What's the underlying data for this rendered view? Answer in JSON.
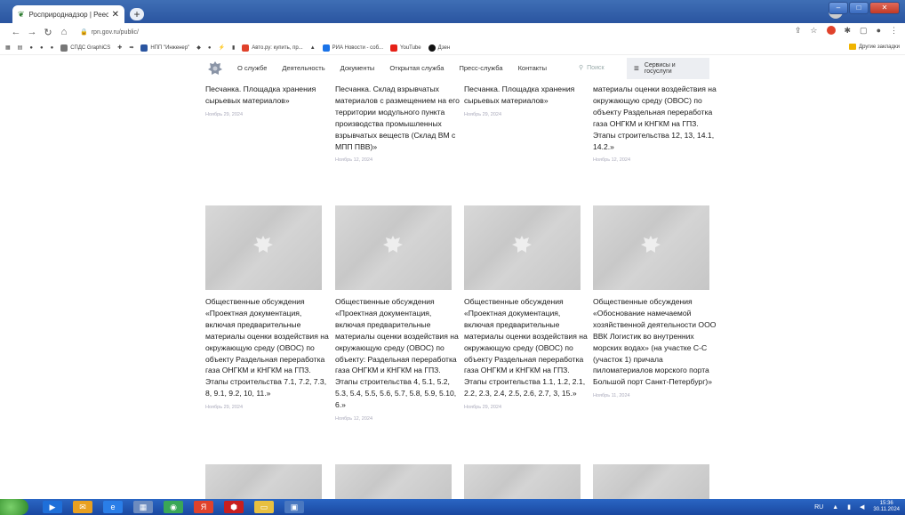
{
  "browser": {
    "tab_title": "Росприроднадзор | Реестр мате",
    "tab_close": "✕",
    "new_tab": "+",
    "url": "rpn.gov.ru/public/",
    "nav_back": "←",
    "nav_forward": "→",
    "nav_reload": "↻",
    "nav_home": "⌂",
    "bookmarks": [
      {
        "label": "СПДС GraphiCS",
        "color": "#777"
      },
      {
        "label": "НПП \"Инженер\"",
        "color": "#2a55a0"
      },
      {
        "label": "Авто.ру: купить, пр...",
        "color": "#e0422b"
      },
      {
        "label": "РИА Новости - соб...",
        "color": "#1a73e8"
      },
      {
        "label": "YouTube",
        "color": "#e62117"
      },
      {
        "label": "Дзен",
        "color": "#111"
      }
    ],
    "other_bookmarks": "Другие закладки"
  },
  "site": {
    "menu": [
      "О службе",
      "Деятельность",
      "Документы",
      "Открытая служба",
      "Пресс-служба",
      "Контакты"
    ],
    "search_placeholder": "Поиск",
    "services_line1": "Сервисы и",
    "services_line2": "госуслуги"
  },
  "top_cards": [
    {
      "title": "Песчанка. Площадка хранения сырьевых материалов»",
      "date": "Ноябрь 29, 2024"
    },
    {
      "title": "Песчанка. Склад взрывчатых материалов с размещением на его территории модульного пункта производства промышленных взрывчатых веществ (Склад ВМ с МПП ПВВ)»",
      "date": "Ноябрь 12, 2024"
    },
    {
      "title": "Песчанка. Площадка хранения сырьевых материалов»",
      "date": "Ноябрь 29, 2024"
    },
    {
      "title": "материалы оценки воздействия на окружающую среду (ОВОС) по объекту Раздельная переработка газа ОНГКМ и КНГКМ на ГПЗ. Этапы строительства 12, 13, 14.1, 14.2.»",
      "date": "Ноябрь 12, 2024"
    }
  ],
  "cards": [
    {
      "title": "Общественные обсуждения «Проектная документация, включая предварительные материалы оценки воздействия на окружающую среду (ОВОС) по объекту Раздельная переработка газа ОНГКМ и КНГКМ на ГПЗ. Этапы строительства 7.1, 7.2, 7.3, 8, 9.1, 9.2, 10, 11.»",
      "date": "Ноябрь 29, 2024"
    },
    {
      "title": "Общественные обсуждения «Проектная документация, включая предварительные материалы оценки воздействия на окружающую среду (ОВОС) по объекту: Раздельная переработка газа ОНГКМ и КНГКМ на ГПЗ. Этапы строительства 4, 5.1, 5.2, 5.3, 5.4, 5.5, 5.6, 5.7, 5.8, 5.9, 5.10, 6.»",
      "date": "Ноябрь 12, 2024"
    },
    {
      "title": "Общественные обсуждения «Проектная документация, включая предварительные материалы оценки воздействия на окружающую среду (ОВОС) по объекту Раздельная переработка газа ОНГКМ и КНГКМ на ГПЗ. Этапы строительства 1.1, 1.2, 2.1, 2.2, 2.3, 2.4, 2.5, 2.6, 2.7, 3, 15.»",
      "date": "Ноябрь 29, 2024"
    },
    {
      "title": "Общественные обсуждения «Обоснование намечаемой хозяйственной деятельности ООО ВВК Логистик во внутренних морских водах» (на участке С-С (участок 1) причала пиломатериалов морского порта Большой порт Санкт-Петербург)»",
      "date": "Ноябрь 11, 2024"
    }
  ],
  "taskbar": {
    "lang": "RU",
    "time": "15:36",
    "date": "30.11.2024"
  }
}
